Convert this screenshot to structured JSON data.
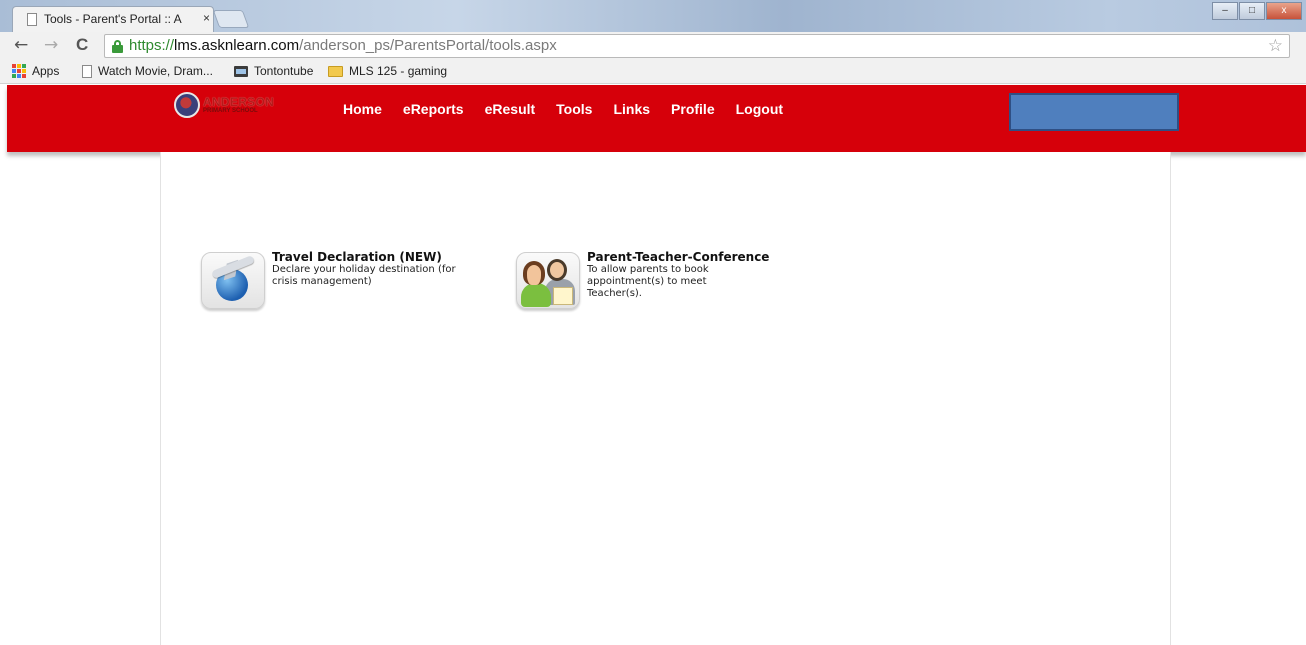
{
  "browser": {
    "tab_title": "Tools - Parent's Portal :: A",
    "tab_close": "×",
    "url_scheme": "https://",
    "url_host": "lms.asknlearn.com",
    "url_path": "/anderson_ps/ParentsPortal/tools.aspx",
    "back_glyph": "←",
    "forward_glyph": "→",
    "reload_glyph": "C",
    "star_glyph": "☆",
    "window_buttons": {
      "minimize": "–",
      "maximize": "□",
      "close": "x"
    },
    "bookmarks": [
      {
        "label": "Apps",
        "icon": "apps-grid-icon"
      },
      {
        "label": "Watch Movie, Dram...",
        "icon": "page-icon"
      },
      {
        "label": "Tontontube",
        "icon": "film-icon"
      },
      {
        "label": "MLS 125 - gaming",
        "icon": "folder-icon"
      }
    ]
  },
  "site": {
    "logo_name": "ANDERSON",
    "logo_sub": "PRIMARY SCHOOL",
    "nav": [
      "Home",
      "eReports",
      "eResult",
      "Tools",
      "Links",
      "Profile",
      "Logout"
    ],
    "colors": {
      "header": "#d6000a",
      "user_box": "#4f7fbe"
    }
  },
  "tools": [
    {
      "title": "Travel Declaration (NEW)",
      "description": "Declare your holiday destination (for crisis management)",
      "icon": "globe-airplane-icon"
    },
    {
      "title": "Parent-Teacher-Conference",
      "description": "To allow parents to book appointment(s) to meet Teacher(s).",
      "icon": "parent-teacher-icon"
    }
  ]
}
